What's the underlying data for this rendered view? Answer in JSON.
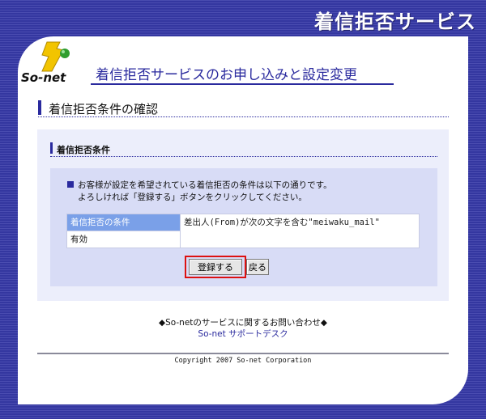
{
  "header": {
    "service_title": "着信拒否サービス"
  },
  "logo": {
    "text": "So-net"
  },
  "page": {
    "heading": "着信拒否サービスのお申し込みと設定変更",
    "section_title": "着信拒否条件の確認"
  },
  "box": {
    "title": "着信拒否条件",
    "note_line1": "お客様が設定を希望されている着信拒否の条件は以下の通りです。",
    "note_line2": "よろしければ「登録する」ボタンをクリックしてください。"
  },
  "table": {
    "rows": [
      {
        "label": "着信拒否の条件",
        "value": "差出人(From)が次の文字を含む\"meiwaku_mail\""
      },
      {
        "label": "有効",
        "value": ""
      }
    ]
  },
  "buttons": {
    "submit_label": "登録する",
    "back_label": "戻る"
  },
  "footer": {
    "contact_text": "◆So-netのサービスに関するお問い合わせ◆",
    "support_link": "So-net サポートデスク",
    "copyright": "Copyright 2007 So-net Corporation"
  },
  "colors": {
    "brand_blue": "#2a2a9e",
    "highlight_red": "#dd1111",
    "logo_yellow": "#f2c400",
    "logo_green": "#2f9e2f"
  }
}
